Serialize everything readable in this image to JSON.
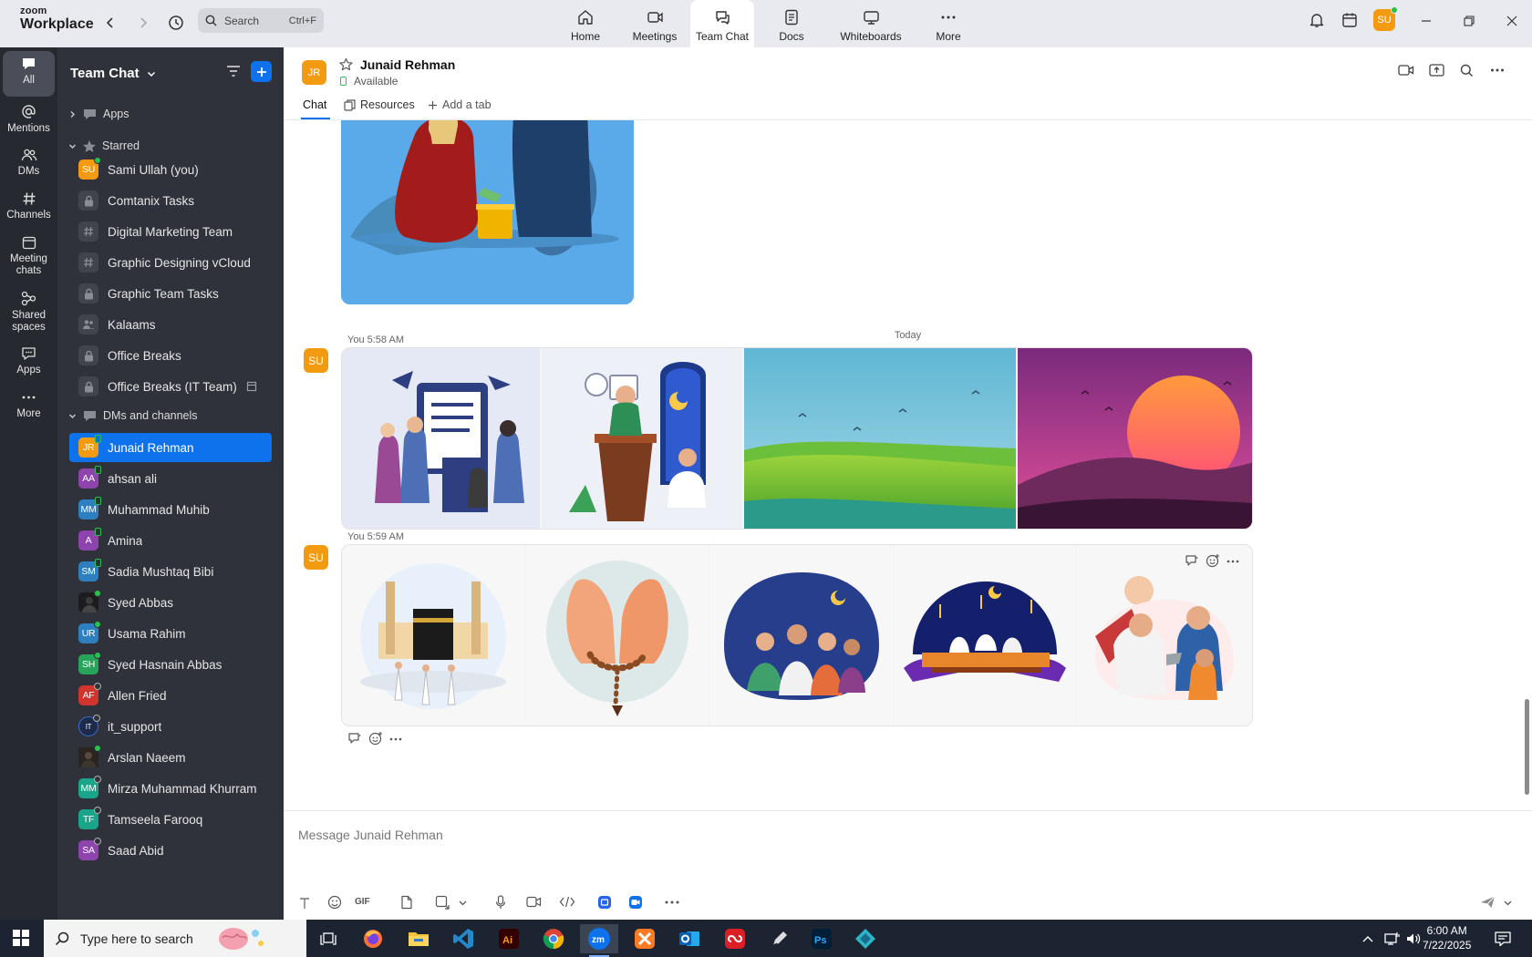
{
  "app": {
    "logo_line1": "zoom",
    "logo_line2": "Workplace"
  },
  "topbar": {
    "search_placeholder": "Search",
    "search_shortcut": "Ctrl+F",
    "tabs": [
      {
        "label": "Home",
        "icon": "home-icon"
      },
      {
        "label": "Meetings",
        "icon": "video-camera-icon"
      },
      {
        "label": "Team Chat",
        "icon": "chat-bubble-icon",
        "active": true
      },
      {
        "label": "Docs",
        "icon": "document-icon"
      },
      {
        "label": "Whiteboards",
        "icon": "whiteboard-icon"
      },
      {
        "label": "More",
        "icon": "more-dots-icon"
      }
    ],
    "avatar_initials": "SU"
  },
  "rail": {
    "items": [
      {
        "label": "All",
        "icon": "chat-icon",
        "active": true
      },
      {
        "label": "Mentions",
        "icon": "at-sign-icon"
      },
      {
        "label": "DMs",
        "icon": "people-icon"
      },
      {
        "label": "Channels",
        "icon": "hash-icon"
      },
      {
        "label_line1": "Meeting",
        "label_line2": "chats",
        "icon": "calendar-icon"
      },
      {
        "label_line1": "Shared",
        "label_line2": "spaces",
        "icon": "shared-spaces-icon"
      },
      {
        "label": "Apps",
        "icon": "apps-icon"
      },
      {
        "label": "More",
        "icon": "more-dots-icon"
      }
    ]
  },
  "sidebar": {
    "title": "Team Chat",
    "sections": {
      "apps": "Apps",
      "starred": "Starred",
      "dms": "DMs and channels"
    },
    "starred": [
      {
        "label": "Sami Ullah (you)",
        "initials": "SU",
        "color": "#f29b10",
        "status": "on"
      },
      {
        "label": "Comtanix Tasks",
        "kind": "lock"
      },
      {
        "label": "Digital Marketing Team",
        "kind": "hash"
      },
      {
        "label": "Graphic Designing vCloud",
        "kind": "hash"
      },
      {
        "label": "Graphic Team Tasks",
        "kind": "lock"
      },
      {
        "label": "Kalaams",
        "kind": "group"
      },
      {
        "label": "Office Breaks",
        "kind": "lock"
      },
      {
        "label": "Office Breaks (IT Team)",
        "kind": "lock"
      }
    ],
    "dms": [
      {
        "label": "Junaid Rehman",
        "initials": "JR",
        "color": "#f29b10",
        "status": "mob",
        "active": true
      },
      {
        "label": "ahsan ali",
        "initials": "AA",
        "color": "#8e44ad",
        "status": "mob"
      },
      {
        "label": "Muhammad Muhib",
        "initials": "MM",
        "color": "#2d7fbf",
        "status": "mob"
      },
      {
        "label": "Amina",
        "initials": "A",
        "color": "#8e44ad",
        "status": "mob"
      },
      {
        "label": "Sadia Mushtaq Bibi",
        "initials": "SM",
        "color": "#2d7fbf",
        "status": "mob"
      },
      {
        "label": "Syed Abbas",
        "initials": "",
        "color": "#1c1c1c",
        "status": "on"
      },
      {
        "label": "Usama Rahim",
        "initials": "UR",
        "color": "#2d7fbf",
        "status": "on"
      },
      {
        "label": "Syed Hasnain Abbas",
        "initials": "SH",
        "color": "#27a35a",
        "status": "on"
      },
      {
        "label": "Allen Fried",
        "initials": "AF",
        "color": "#d0342c",
        "status": "off"
      },
      {
        "label": "it_support",
        "initials": "IT",
        "color": "#1c2b4a",
        "status": "off"
      },
      {
        "label": "Arslan Naeem",
        "initials": "",
        "color": "#1c1c1c",
        "status": "on"
      },
      {
        "label": "Mirza Muhammad Khurram",
        "initials": "MM",
        "color": "#1aa58a",
        "status": "off"
      },
      {
        "label": "Tamseela Farooq",
        "initials": "TF",
        "color": "#1aa58a",
        "status": "off"
      },
      {
        "label": "Saad Abid",
        "initials": "SA",
        "color": "#8e44ad",
        "status": "off"
      }
    ]
  },
  "chat": {
    "contact_initials": "JR",
    "contact_name": "Junaid Rehman",
    "status": "Available",
    "tabs": {
      "chat": "Chat",
      "resources": "Resources",
      "add": "Add a tab"
    },
    "day_divider": "Today",
    "messages": [
      {
        "sender_initials": "SU",
        "meta": "You 5:58 AM",
        "images": 4
      },
      {
        "sender_initials": "SU",
        "meta": "You 5:59 AM",
        "images": 5
      }
    ],
    "composer_placeholder": "Message Junaid Rehman",
    "composer_gif": "GIF"
  },
  "taskbar": {
    "search_placeholder": "Type here to search",
    "time": "6:00 AM",
    "date": "7/22/2025"
  }
}
